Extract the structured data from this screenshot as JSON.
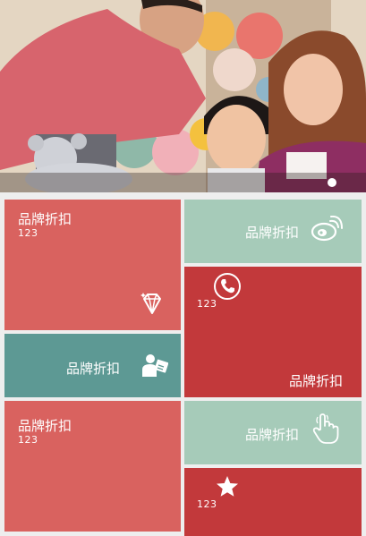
{
  "colors": {
    "coral": "#d9625f",
    "mint": "#a6cbb9",
    "teal": "#5d9994",
    "crimson": "#c2393b",
    "background": "#eeeeee"
  },
  "banner": {
    "image": "family-photo",
    "page_indicator": {
      "count": 1,
      "active": 1
    }
  },
  "tiles": [
    {
      "label": "品牌折扣",
      "count": "123",
      "icon": "diamond-icon",
      "color": "coral"
    },
    {
      "label": "品牌折扣",
      "icon": "weibo-icon",
      "color": "mint"
    },
    {
      "label": "品牌折扣",
      "count": "123",
      "icon": "phone-icon",
      "color": "crimson"
    },
    {
      "label": "品牌折扣",
      "icon": "person-ticket-icon",
      "color": "teal"
    },
    {
      "label": "品牌折扣",
      "count": "123",
      "color": "coral"
    },
    {
      "label": "品牌折扣",
      "icon": "hand-pointer-icon",
      "color": "mint"
    },
    {
      "count": "123",
      "icon": "star-icon",
      "color": "crimson"
    }
  ]
}
